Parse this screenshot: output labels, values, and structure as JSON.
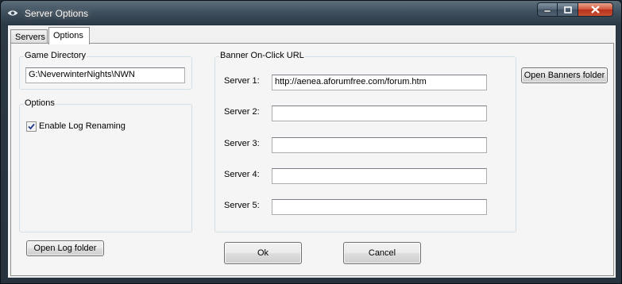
{
  "window": {
    "title": "Server Options"
  },
  "tabs": [
    {
      "label": "Servers"
    },
    {
      "label": "Options"
    }
  ],
  "game_directory": {
    "label": "Game Directory",
    "value": "G:\\NeverwinterNights\\NWN"
  },
  "options": {
    "label": "Options",
    "enable_log_renaming": {
      "label": "Enable Log Renaming",
      "checked": true
    }
  },
  "banner": {
    "label": "Banner On-Click URL",
    "servers": [
      {
        "label": "Server 1:",
        "value": "http://aenea.aforumfree.com/forum.htm"
      },
      {
        "label": "Server 2:",
        "value": ""
      },
      {
        "label": "Server 3:",
        "value": ""
      },
      {
        "label": "Server 4:",
        "value": ""
      },
      {
        "label": "Server 5:",
        "value": ""
      }
    ]
  },
  "buttons": {
    "open_banners_folder": "Open Banners folder",
    "open_log_folder": "Open Log folder",
    "ok": "Ok",
    "cancel": "Cancel"
  },
  "icons": {
    "app": "nwn-eye-icon",
    "minimize": "minimize-icon",
    "maximize": "maximize-icon",
    "close": "close-icon"
  }
}
